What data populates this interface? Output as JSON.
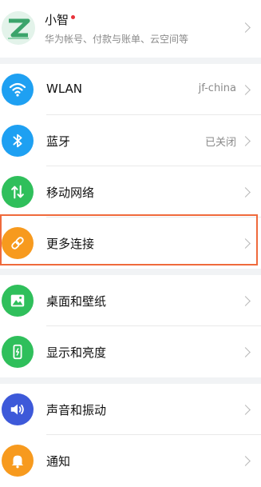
{
  "account": {
    "name": "小智",
    "subtitle": "华为帐号、付款与账单、云空间等",
    "avatar_icon": "huawei-account-avatar-icon"
  },
  "settings": {
    "items": [
      {
        "label": "WLAN",
        "value": "jf-china",
        "icon": "wifi-icon",
        "color": "#1ea0f2"
      },
      {
        "label": "蓝牙",
        "value": "已关闭",
        "icon": "bluetooth-icon",
        "color": "#1ea0f2"
      },
      {
        "label": "移动网络",
        "value": "",
        "icon": "mobile-data-icon",
        "color": "#2fbf5b"
      },
      {
        "label": "更多连接",
        "value": "",
        "icon": "link-icon",
        "color": "#f79a1e"
      },
      {
        "label": "桌面和壁纸",
        "value": "",
        "icon": "wallpaper-icon",
        "color": "#2fbf5b"
      },
      {
        "label": "显示和亮度",
        "value": "",
        "icon": "display-icon",
        "color": "#2fbf5b"
      },
      {
        "label": "声音和振动",
        "value": "",
        "icon": "sound-icon",
        "color": "#3d59d9"
      },
      {
        "label": "通知",
        "value": "",
        "icon": "bell-icon",
        "color": "#f79a1e"
      }
    ]
  },
  "highlight_color": "#ef6a3c"
}
